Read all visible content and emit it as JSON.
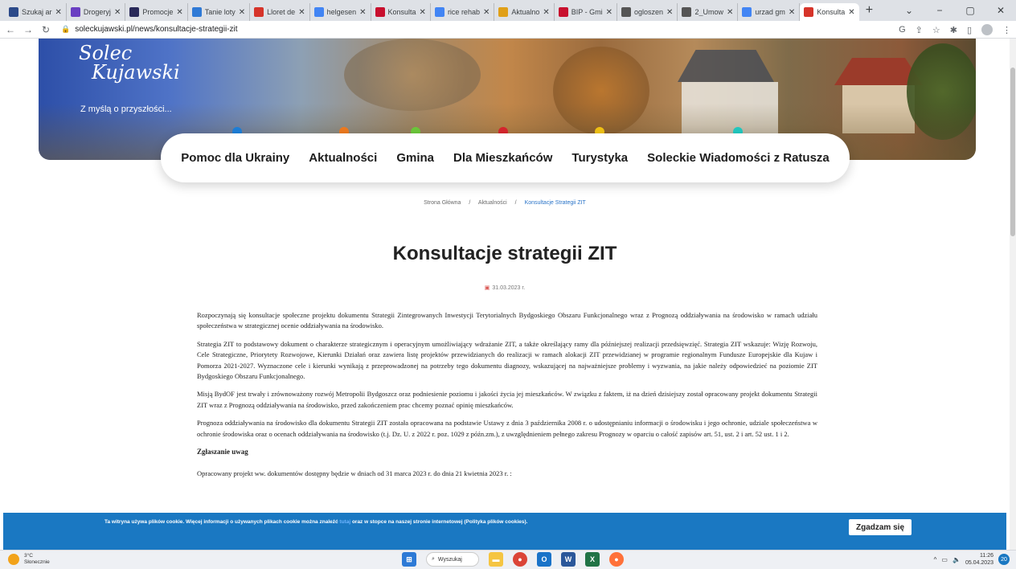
{
  "browser": {
    "tabs": [
      {
        "label": "Szukaj ar",
        "icon": "search-favicon",
        "color": "#2c4a8a"
      },
      {
        "label": "Drogeryj",
        "icon": "drogeria-favicon",
        "color": "#6a3fc2"
      },
      {
        "label": "Promocje",
        "icon": "promocje-favicon",
        "color": "#2a2a5a"
      },
      {
        "label": "Tanie loty",
        "icon": "flights-favicon",
        "color": "#2f7ad6"
      },
      {
        "label": "Lloret de",
        "icon": "lloret-favicon",
        "color": "#d6342a"
      },
      {
        "label": "helgesen",
        "icon": "google-favicon",
        "color": "#4285f4"
      },
      {
        "label": "Konsulta",
        "icon": "konsulta-favicon",
        "color": "#c8102e"
      },
      {
        "label": "rice rehab",
        "icon": "google-favicon",
        "color": "#4285f4"
      },
      {
        "label": "Aktualno",
        "icon": "aktualnosci-favicon",
        "color": "#e0a019"
      },
      {
        "label": "BIP - Gmi",
        "icon": "bip-favicon",
        "color": "#c8102e"
      },
      {
        "label": "ogloszen",
        "icon": "globe-favicon",
        "color": "#555"
      },
      {
        "label": "2_Umow",
        "icon": "globe-favicon",
        "color": "#555"
      },
      {
        "label": "urzad gm",
        "icon": "google-favicon",
        "color": "#4285f4"
      },
      {
        "label": "Konsulta",
        "icon": "solec-favicon",
        "color": "#d6342a"
      }
    ],
    "url": "soleckujawski.pl/news/konsultacje-strategii-zit"
  },
  "site": {
    "logo_line1": "Solec",
    "logo_line2": "Kujawski",
    "tagline": "Z myślą o przyszłości...",
    "nav": [
      {
        "label": "Pomoc dla Ukrainy",
        "dot": "#1e7fd8"
      },
      {
        "label": "Aktualności",
        "dot": "#ee7a1f"
      },
      {
        "label": "Gmina",
        "dot": "#6cc83b"
      },
      {
        "label": "Dla Mieszkańców",
        "dot": "#d7262d"
      },
      {
        "label": "Turystyka",
        "dot": "#f2c314"
      },
      {
        "label": "Soleckie Wiadomości z Ratusza",
        "dot": "#22c9c0"
      }
    ]
  },
  "breadcrumb": {
    "home": "Strona Główna",
    "section": "Aktualności",
    "current": "Konsultacje Strategii ZIT"
  },
  "article": {
    "title": "Konsultacje strategii ZIT",
    "date": "31.03.2023 r.",
    "paragraphs": [
      "Rozpoczynają się konsultacje społeczne projektu dokumentu Strategii Zintegrowanych Inwestycji Terytorialnych Bydgoskiego Obszaru Funkcjonalnego wraz z Prognozą oddziaływania na środowisko w ramach udziału społeczeństwa w strategicznej ocenie oddziaływania na środowisko.",
      "Strategia ZIT to podstawowy dokument o charakterze strategicznym i operacyjnym umożliwiający wdrażanie ZIT, a także określający ramy dla późniejszej realizacji przedsięwzięć. Strategia ZIT wskazuje: Wizję Rozwoju, Cele Strategiczne, Priorytety Rozwojowe, Kierunki Działań oraz zawiera listę projektów przewidzianych do realizacji w ramach alokacji ZIT przewidzianej w programie regionalnym Fundusze Europejskie dla Kujaw i Pomorza 2021-2027. Wyznaczone cele i kierunki wynikają z przeprowadzonej na potrzeby tego dokumentu diagnozy, wskazującej na najważniejsze problemy i wyzwania, na jakie należy odpowiedzieć na poziomie ZIT Bydgoskiego Obszaru Funkcjonalnego.",
      "Misją BydOF jest trwały i zrównoważony rozwój Metropolii Bydgoszcz oraz podniesienie poziomu i jakości życia jej mieszkańców. W związku z faktem, iż na dzień dzisiejszy został opracowany projekt dokumentu Strategii ZIT wraz z Prognozą oddziaływania na środowisko, przed zakończeniem prac chcemy poznać opinię mieszkańców.",
      "Prognoza oddziaływania na środowisko dla dokumentu Strategii ZIT została opracowana na podstawie Ustawy z dnia 3 października 2008 r. o udostępnianiu informacji o środowisku i jego ochronie, udziale społeczeństwa w ochronie środowiska oraz o ocenach oddziaływania na środowisko (t.j. Dz. U. z 2022 r. poz. 1029 z późn.zm.), z uwzględnieniem pełnego zakresu Prognozy w oparciu o całość zapisów art. 51, ust. 2 i art. 52 ust. 1 i 2."
    ],
    "subheading": "Zgłaszanie uwag",
    "last_line": "Opracowany projekt ww. dokumentów dostępny będzie w dniach od 31 marca 2023 r. do dnia  21 kwietnia 2023 r. :"
  },
  "cookie": {
    "text_before": "Ta witryna używa plików cookie. Więcej informacji o używanych plikach cookie można znaleźć ",
    "link": "tutaj",
    "text_after": " oraz w stopce na naszej stronie internetowej (Polityka plików cookies).",
    "button": "Zgadzam się"
  },
  "taskbar": {
    "temp": "3°C",
    "weather": "Słonecznie",
    "search": "Wyszukaj",
    "time": "11:26",
    "date": "05.04.2023",
    "notifications": "20"
  }
}
